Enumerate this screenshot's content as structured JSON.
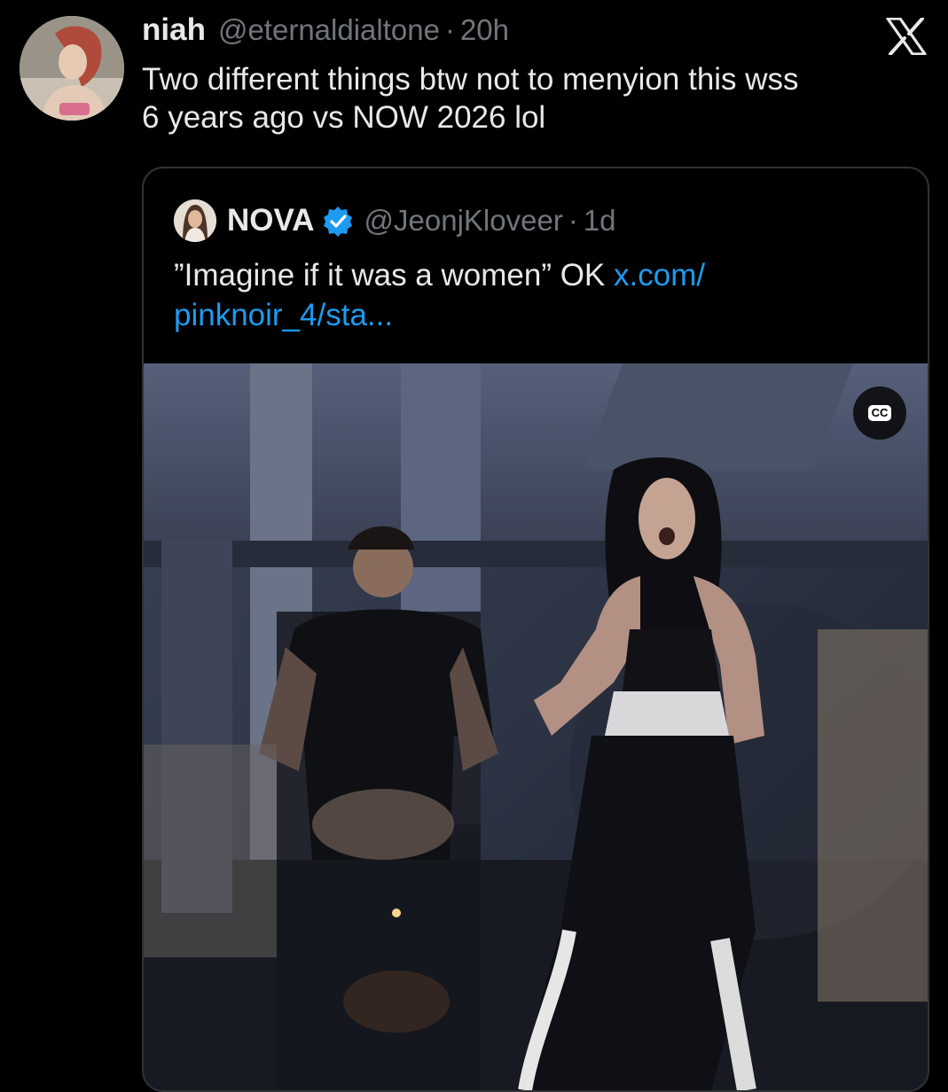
{
  "tweet": {
    "display_name": "niah",
    "handle": "@eternaldialtone",
    "separator": "·",
    "time": "20h",
    "text_line1": "Two different things btw not to menyion this wss",
    "text_line2": "6 years ago vs NOW 2026 lol"
  },
  "quote": {
    "display_name": "NOVA",
    "handle": "@JeonjKloveer",
    "separator": "·",
    "time": "1d",
    "text_prefix": "”Imagine if it was a women” OK ",
    "link_part1": "x.com/",
    "link_part2": "pinknoir_4/sta..."
  },
  "media": {
    "cc_label": "CC"
  },
  "icons": {
    "brand": "x-logo-icon",
    "verified": "verified-badge-icon",
    "captions": "closed-captions-icon"
  },
  "colors": {
    "background": "#000000",
    "text": "#e7e9ea",
    "muted": "#71767b",
    "link": "#1d9bf0",
    "border": "#2f3336"
  }
}
